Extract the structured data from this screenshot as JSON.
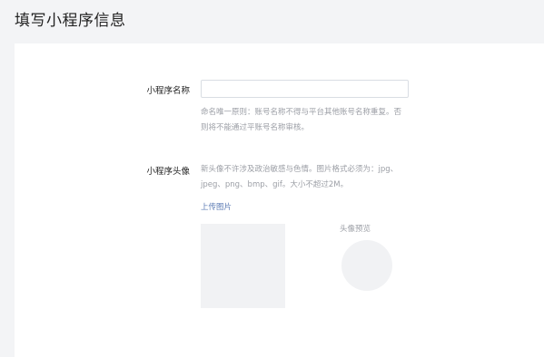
{
  "page": {
    "title": "填写小程序信息"
  },
  "form": {
    "name_label": "小程序名称",
    "name_value": "",
    "name_hint_line1": "命名唯一原则：账号名称不得与平台其他账号名称重复。否",
    "name_hint_line2": "则将不能通过平账号名称审核。",
    "avatar_label": "小程序头像",
    "avatar_hint_line1": "新头像不许涉及政治敏感与色情。图片格式必须为：jpg、",
    "avatar_hint_line2": "jpeg、png、bmp、gif。大小不超过2M。",
    "upload_link": "上传图片",
    "preview_label": "头像预览"
  }
}
